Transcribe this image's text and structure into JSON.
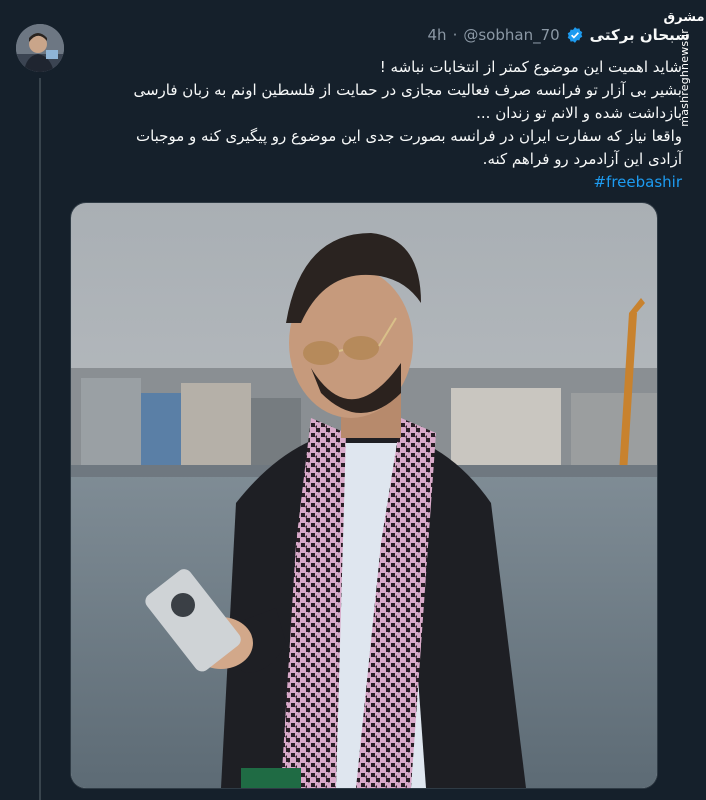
{
  "tweet": {
    "author_name": "سبحان برکتی",
    "handle": "@sobhan_70",
    "separator": "·",
    "time": "4h",
    "lines": [
      "شاید اهمیت این موضوع کمتر از انتخابات نباشه !",
      "بشیر بی آزار تو فرانسه صرف فعالیت مجازی در حمایت از فلسطین اونم به زبان فارسی",
      "بازداشت شده و الانم تو زندان ...",
      "واقعا نیاز که سفارت ایران در فرانسه بصورت جدی این موضوع رو پیگیری کنه و موجبات",
      "آزادی این آزادمرد رو فراهم کنه."
    ],
    "hashtag": "#freebashir"
  },
  "watermark": {
    "logo": "مشرق",
    "site": "mashreghnews.ir"
  },
  "colors": {
    "background": "#15202b",
    "text": "#f7f9f9",
    "muted": "#8b98a5",
    "link": "#1d9bf0",
    "verified": "#1d9bf0"
  },
  "icons": {
    "verified": "verified-badge-icon",
    "avatar": "avatar"
  }
}
